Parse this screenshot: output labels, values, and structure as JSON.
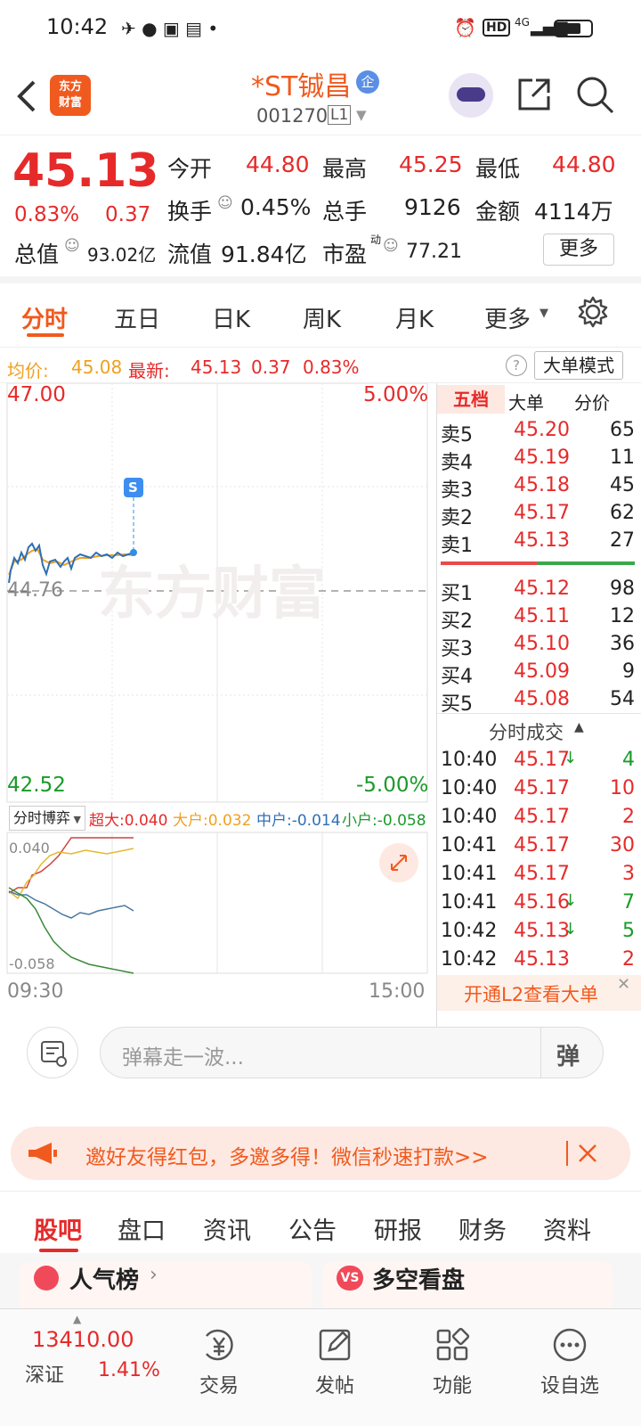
{
  "status": {
    "time": "10:42",
    "net": "4G"
  },
  "header": {
    "logo": "东方财富",
    "title": "*ST铖昌",
    "badge": "企",
    "code": "001270",
    "level": "L1"
  },
  "quote": {
    "price": "45.13",
    "pct": "0.83%",
    "chg": "0.37",
    "open_l": "今开",
    "open_v": "44.80",
    "high_l": "最高",
    "high_v": "45.25",
    "low_l": "最低",
    "low_v": "44.80",
    "turn_l": "换手",
    "turn_v": "0.45%",
    "vol_l": "总手",
    "vol_v": "9126",
    "amt_l": "金额",
    "amt_v": "4114万",
    "mcap_l": "总值",
    "mcap_v": "93.02亿",
    "float_l": "流值",
    "float_v": "91.84亿",
    "pe_l": "市盈",
    "pe_sup": "动",
    "pe_v": "77.21",
    "more": "更多"
  },
  "tabs": [
    "分时",
    "五日",
    "日K",
    "周K",
    "月K",
    "更多"
  ],
  "info": {
    "avg_l": "均价:",
    "avg_v": "45.08",
    "last_l": "最新:",
    "last_v": "45.13",
    "chg": "0.37",
    "pct": "0.83%",
    "mode": "大单模式"
  },
  "chart": {
    "top": "47.00",
    "top_pct": "5.00%",
    "mid": "44.76",
    "bot": "42.52",
    "bot_pct": "-5.00%",
    "marker": "S",
    "watermark": "东方财富",
    "game_btn": "分时博弈",
    "super": "超大:0.040",
    "big": "大户:0.032",
    "mid2": "中户:-0.014",
    "small": "小户:-0.058",
    "sub_top": "0.040",
    "sub_bot": "-0.058",
    "t0": "09:30",
    "t1": "15:00"
  },
  "book": {
    "tabs": [
      "五档",
      "大单",
      "分价"
    ],
    "asks": [
      [
        "卖5",
        "45.20",
        "65"
      ],
      [
        "卖4",
        "45.19",
        "11"
      ],
      [
        "卖3",
        "45.18",
        "45"
      ],
      [
        "卖2",
        "45.17",
        "62"
      ],
      [
        "卖1",
        "45.13",
        "27"
      ]
    ],
    "bids": [
      [
        "买1",
        "45.12",
        "98"
      ],
      [
        "买2",
        "45.11",
        "12"
      ],
      [
        "买3",
        "45.10",
        "36"
      ],
      [
        "买4",
        "45.09",
        "9"
      ],
      [
        "买5",
        "45.08",
        "54"
      ]
    ],
    "ticks_title": "分时成交",
    "ticks": [
      [
        "10:40",
        "45.17",
        "↓",
        "4"
      ],
      [
        "10:40",
        "45.17",
        "",
        "10"
      ],
      [
        "10:40",
        "45.17",
        "",
        "2"
      ],
      [
        "10:41",
        "45.17",
        "",
        "30"
      ],
      [
        "10:41",
        "45.17",
        "",
        "3"
      ],
      [
        "10:41",
        "45.16",
        "↓",
        "7"
      ],
      [
        "10:42",
        "45.13",
        "↓",
        "5"
      ],
      [
        "10:42",
        "45.13",
        "",
        "2"
      ]
    ],
    "l2": "开通L2查看大单"
  },
  "comment": {
    "placeholder": "弹幕走一波...",
    "btn": "弹"
  },
  "banner": {
    "text": "邀好友得红包，多邀多得！微信秒速打款>>"
  },
  "nav2": [
    "股吧",
    "盘口",
    "资讯",
    "公告",
    "研报",
    "财务",
    "资料"
  ],
  "cards": {
    "a": "人气榜",
    "b": "多空看盘"
  },
  "bottom": {
    "index_v": "13410.00",
    "index_n": "深证",
    "index_p": "1.41%",
    "items": [
      "交易",
      "发帖",
      "功能",
      "设自选"
    ]
  },
  "colors": {
    "up": "#e62a2a",
    "down": "#1a9a2a",
    "accent": "#f05a1e"
  }
}
